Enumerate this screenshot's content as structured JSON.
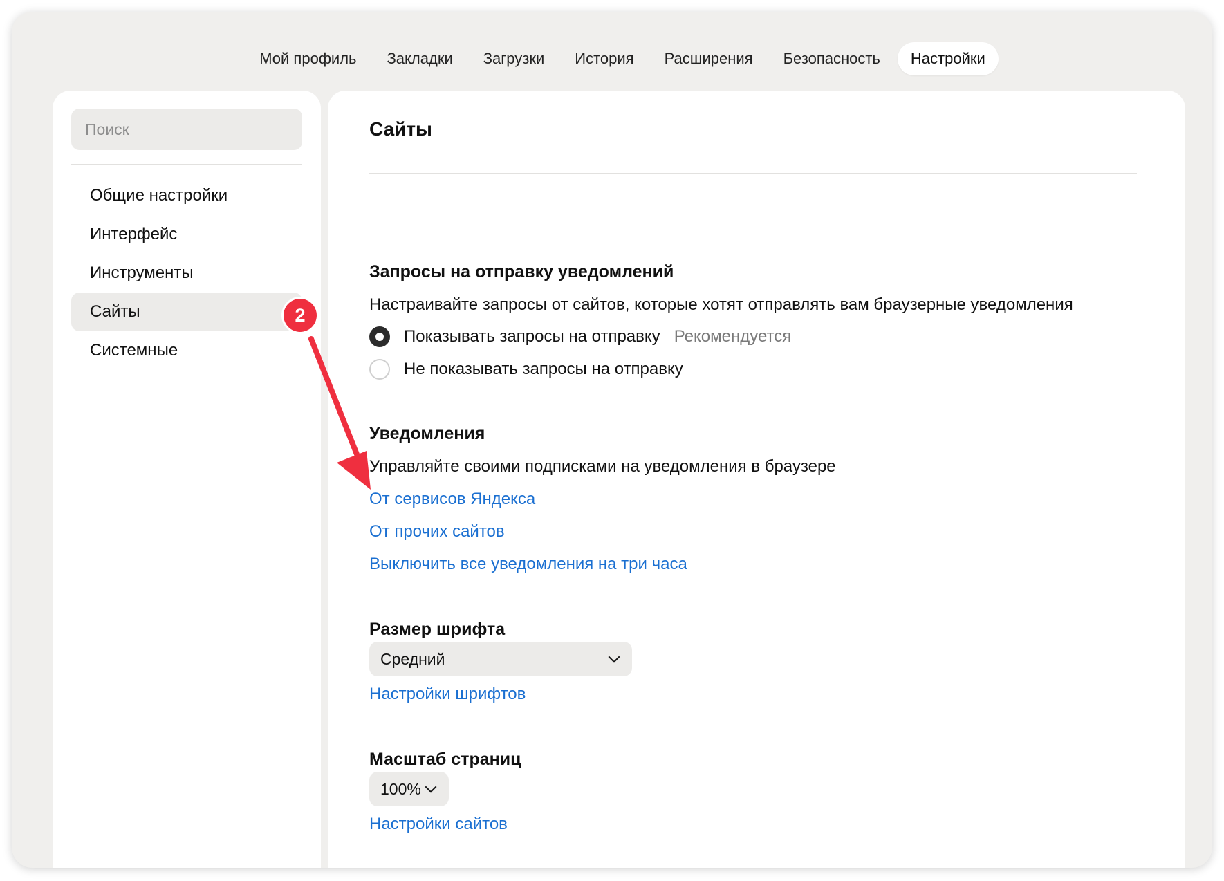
{
  "tabs": [
    {
      "label": "Мой профиль"
    },
    {
      "label": "Закладки"
    },
    {
      "label": "Загрузки"
    },
    {
      "label": "История"
    },
    {
      "label": "Расширения"
    },
    {
      "label": "Безопасность"
    },
    {
      "label": "Настройки"
    }
  ],
  "sidebar": {
    "search_placeholder": "Поиск",
    "items": [
      {
        "label": "Общие настройки"
      },
      {
        "label": "Интерфейс"
      },
      {
        "label": "Инструменты"
      },
      {
        "label": "Сайты"
      },
      {
        "label": "Системные"
      }
    ]
  },
  "annotation": {
    "badge": "2",
    "color": "#ef2f3f"
  },
  "content": {
    "title": "Сайты",
    "notif_requests": {
      "heading": "Запросы на отправку уведомлений",
      "description": "Настраивайте запросы от сайтов, которые хотят отправлять вам браузерные уведомления",
      "option_show": "Показывать запросы на отправку",
      "option_show_hint": "Рекомендуется",
      "option_hide": "Не показывать запросы на отправку"
    },
    "notifications": {
      "heading": "Уведомления",
      "description": "Управляйте своими подписками на уведомления в браузере",
      "link_yandex": "От сервисов Яндекса",
      "link_other": "От прочих сайтов",
      "link_mute": "Выключить все уведомления на три часа"
    },
    "font_size": {
      "heading": "Размер шрифта",
      "value": "Средний",
      "link": "Настройки шрифтов"
    },
    "page_zoom": {
      "heading": "Масштаб страниц",
      "value": "100%",
      "link": "Настройки сайтов"
    }
  },
  "colors": {
    "link": "#1a6fd1",
    "background": "#f0efed",
    "accent_red": "#ef2f3f"
  }
}
